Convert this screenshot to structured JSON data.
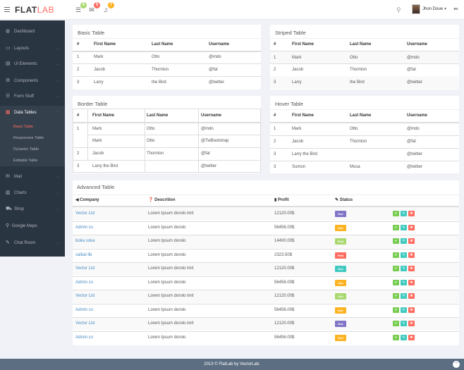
{
  "header": {
    "logo_main": "FLAT",
    "logo_accent": "LAB",
    "notifications": [
      {
        "icon": "tasks-icon",
        "count": "6",
        "color": "#a9d86e"
      },
      {
        "icon": "envelope-icon",
        "count": "5",
        "color": "#ff6c60"
      },
      {
        "icon": "bell-icon",
        "count": "7",
        "color": "#fcb322"
      }
    ],
    "user_name": "Jhon Doue"
  },
  "sidebar": {
    "items": [
      {
        "label": "Dashboard",
        "icon": "dashboard-icon",
        "has_children": false
      },
      {
        "label": "Layouts",
        "icon": "laptop-icon",
        "has_children": true
      },
      {
        "label": "UI Elements",
        "icon": "book-icon",
        "has_children": true
      },
      {
        "label": "Components",
        "icon": "cogs-icon",
        "has_children": true
      },
      {
        "label": "Form Stuff",
        "icon": "tasks-icon",
        "has_children": true
      },
      {
        "label": "Data Tables",
        "icon": "th-icon",
        "has_children": true,
        "active": true
      },
      {
        "label": "Mail",
        "icon": "envelope-icon",
        "has_children": true
      },
      {
        "label": "Charts",
        "icon": "bar-chart-icon",
        "has_children": true
      },
      {
        "label": "Shop",
        "icon": "shopping-cart-icon",
        "has_children": true
      },
      {
        "label": "Google Maps",
        "icon": "map-marker-icon",
        "has_children": false
      },
      {
        "label": "Chat Room",
        "icon": "comments-icon",
        "has_children": true
      }
    ],
    "sub_items": [
      "Basic Table",
      "Responsive Table",
      "Dynamic Table",
      "Editable Table"
    ]
  },
  "basic_table": {
    "title": "Basic Table",
    "headers": [
      "#",
      "First Name",
      "Last Name",
      "Username"
    ],
    "rows": [
      [
        "1",
        "Mark",
        "Otto",
        "@mdo"
      ],
      [
        "2",
        "Jacob",
        "Thornton",
        "@fat"
      ],
      [
        "3",
        "Larry",
        "the Bird",
        "@twitter"
      ]
    ]
  },
  "striped_table": {
    "title": "Striped Table",
    "headers": [
      "#",
      "First Name",
      "Last Name",
      "Username"
    ],
    "rows": [
      [
        "1",
        "Mark",
        "Otto",
        "@mdo"
      ],
      [
        "2",
        "Jacob",
        "Thornton",
        "@fat"
      ],
      [
        "3",
        "Larry",
        "the Bird",
        "@twitter"
      ]
    ]
  },
  "border_table": {
    "title": "Border Table",
    "headers": [
      "#",
      "First Name",
      "Last Name",
      "Username"
    ],
    "rows": [
      [
        "1",
        "Mark",
        "Otto",
        "@mdo"
      ],
      [
        "",
        "Mark",
        "Otto",
        "@TwBootstrap"
      ],
      [
        "2",
        "Jacob",
        "Thornton",
        "@fat"
      ],
      [
        "3",
        "Larry the Bird",
        "",
        "@twitter"
      ]
    ]
  },
  "hover_table": {
    "title": "Hover Table",
    "headers": [
      "#",
      "First Name",
      "Last Name",
      "Username"
    ],
    "rows": [
      [
        "1",
        "Mark",
        "Otto",
        "@mdo"
      ],
      [
        "2",
        "Jacob",
        "Thornton",
        "@fat"
      ],
      [
        "3",
        "Larry the Bird",
        "",
        "@twitter"
      ],
      [
        "3",
        "Sumon",
        "Mosa",
        "@twitter"
      ]
    ]
  },
  "advanced_table": {
    "title": "Advanced Table",
    "headers": [
      "Company",
      "Descrition",
      "Profit",
      "Status"
    ],
    "rows": [
      {
        "company": "Vector Ltd",
        "desc": "Lorem Ipsum dorolo imit",
        "profit": "12120.00$",
        "status": "Due",
        "color": "#8175c7"
      },
      {
        "company": "Admin co",
        "desc": "Lorem Ipsum dorolo",
        "profit": "56456.00$",
        "status": "Due",
        "color": "#fcb322"
      },
      {
        "company": "boka soka",
        "desc": "Lorem Ipsum dorolo",
        "profit": "14400.00$",
        "status": "Paid",
        "color": "#a9d86e"
      },
      {
        "company": "salbal llb",
        "desc": "Lorem Ipsum dorolo",
        "profit": "2323.50$",
        "status": "Paid",
        "color": "#ff6c60"
      },
      {
        "company": "Vector Ltd",
        "desc": "Lorem Ipsum dorolo imit",
        "profit": "12120.00$",
        "status": "Due",
        "color": "#41cac0"
      },
      {
        "company": "Admin co",
        "desc": "Lorem Ipsum dorolo",
        "profit": "56456.00$",
        "status": "Due",
        "color": "#fcb322"
      },
      {
        "company": "Vector Ltd",
        "desc": "Lorem Ipsum dorolo imit",
        "profit": "12120.00$",
        "status": "Due",
        "color": "#a9d86e"
      },
      {
        "company": "Admin co",
        "desc": "Lorem Ipsum dorolo",
        "profit": "56456.00$",
        "status": "Due",
        "color": "#fcb322"
      },
      {
        "company": "Vector Ltd",
        "desc": "Lorem Ipsum dorolo imit",
        "profit": "12120.00$",
        "status": "Due",
        "color": "#8175c7"
      },
      {
        "company": "Admin co",
        "desc": "Lorem Ipsum dorolo",
        "profit": "56456.00$",
        "status": "Due",
        "color": "#fcb322"
      }
    ],
    "actions": [
      {
        "name": "check-icon",
        "color": "#78cd51"
      },
      {
        "name": "pencil-icon",
        "color": "#41cac0"
      },
      {
        "name": "trash-icon",
        "color": "#ff6c60"
      }
    ]
  },
  "footer": {
    "text": "2013 © FlatLab by VectorLab."
  }
}
